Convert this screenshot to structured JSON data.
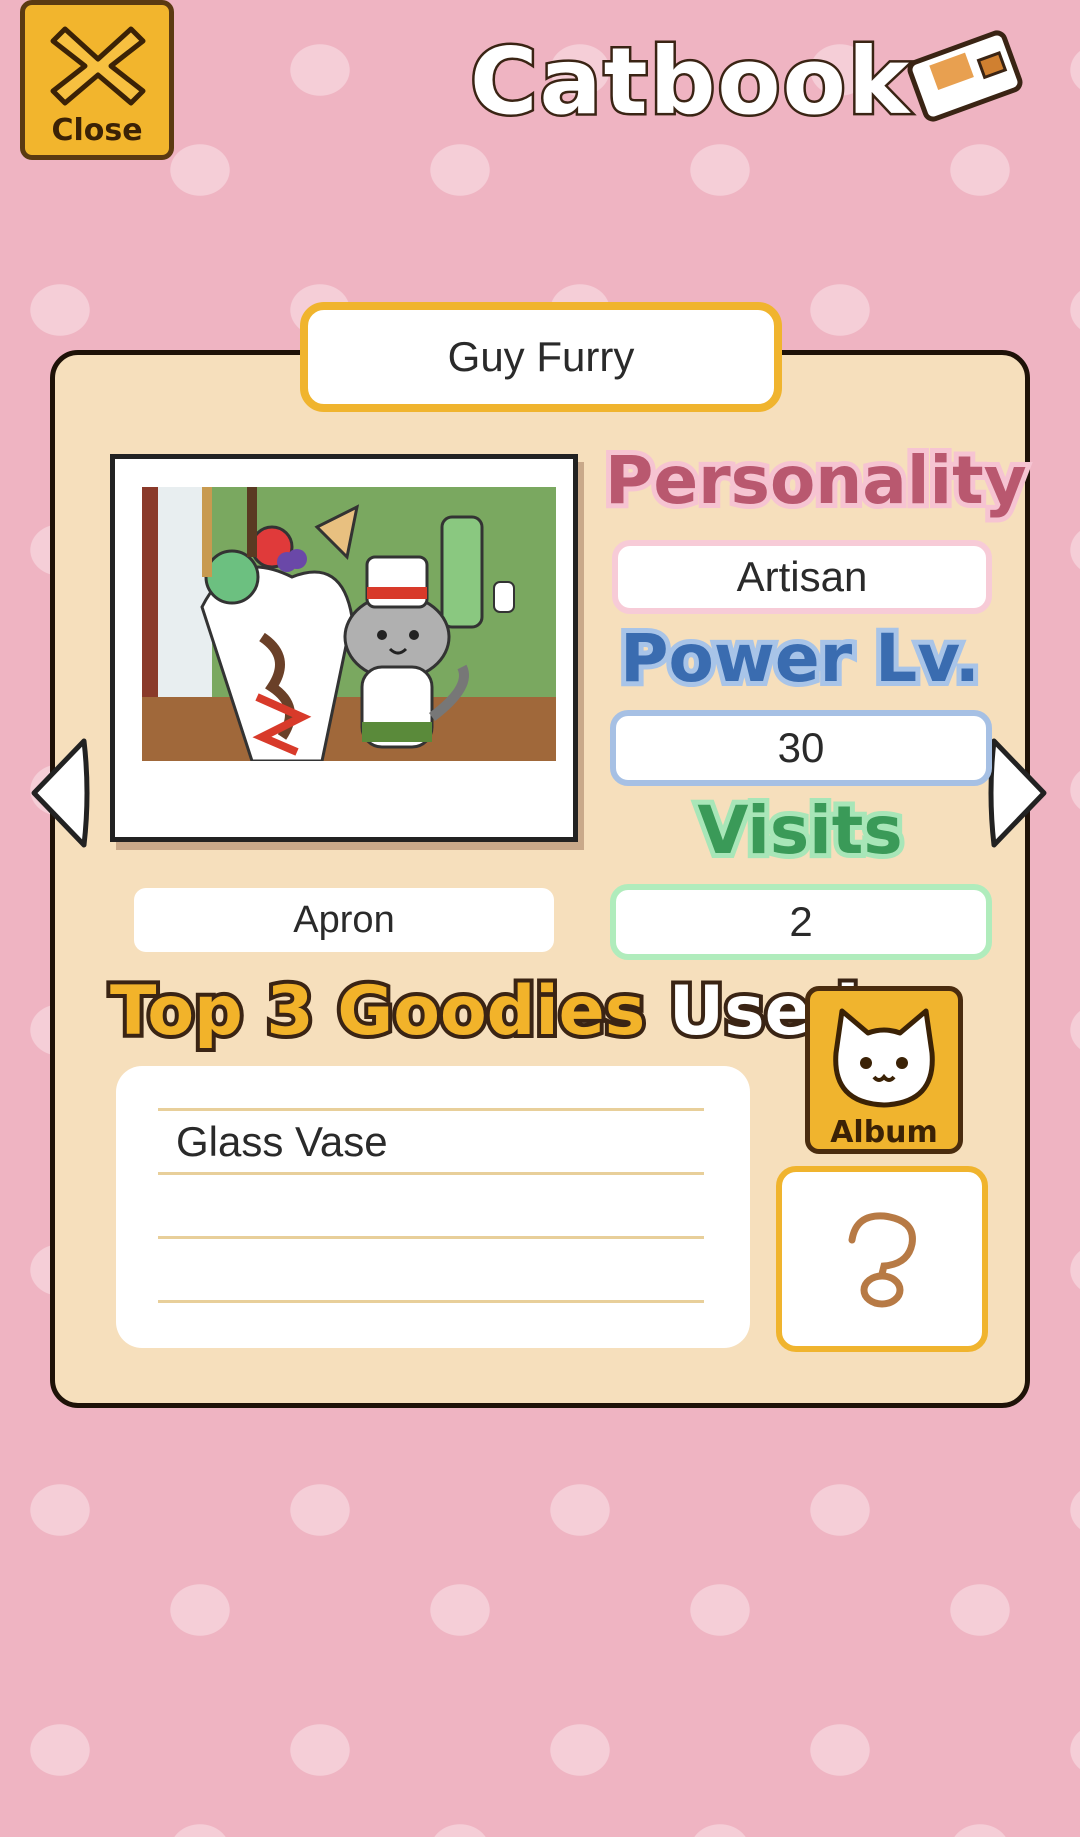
{
  "header": {
    "close_label": "Close",
    "title": "Catbook"
  },
  "cat": {
    "name": "Guy Furry",
    "item": "Apron"
  },
  "stats": {
    "personality_label": "Personality",
    "personality_value": "Artisan",
    "power_label": "Power Lv.",
    "power_value": "30",
    "visits_label": "Visits",
    "visits_value": "2"
  },
  "goodies": {
    "title_part1": "Top 3 Goodies",
    "title_part2": "Used",
    "items": [
      "Glass Vase",
      "",
      ""
    ]
  },
  "buttons": {
    "album_label": "Album"
  },
  "icons": {
    "close": "close-x-icon",
    "catbook": "notebook-icon",
    "prev": "left-arrow-icon",
    "next": "right-arrow-icon",
    "album": "cat-face-icon",
    "help": "question-mark-icon"
  },
  "colors": {
    "background": "#efb4c2",
    "card": "#f6dfbc",
    "accent": "#f0b42e",
    "personality": "#f7cbd7",
    "power": "#a6c0e4",
    "visits": "#b0ecbc"
  }
}
